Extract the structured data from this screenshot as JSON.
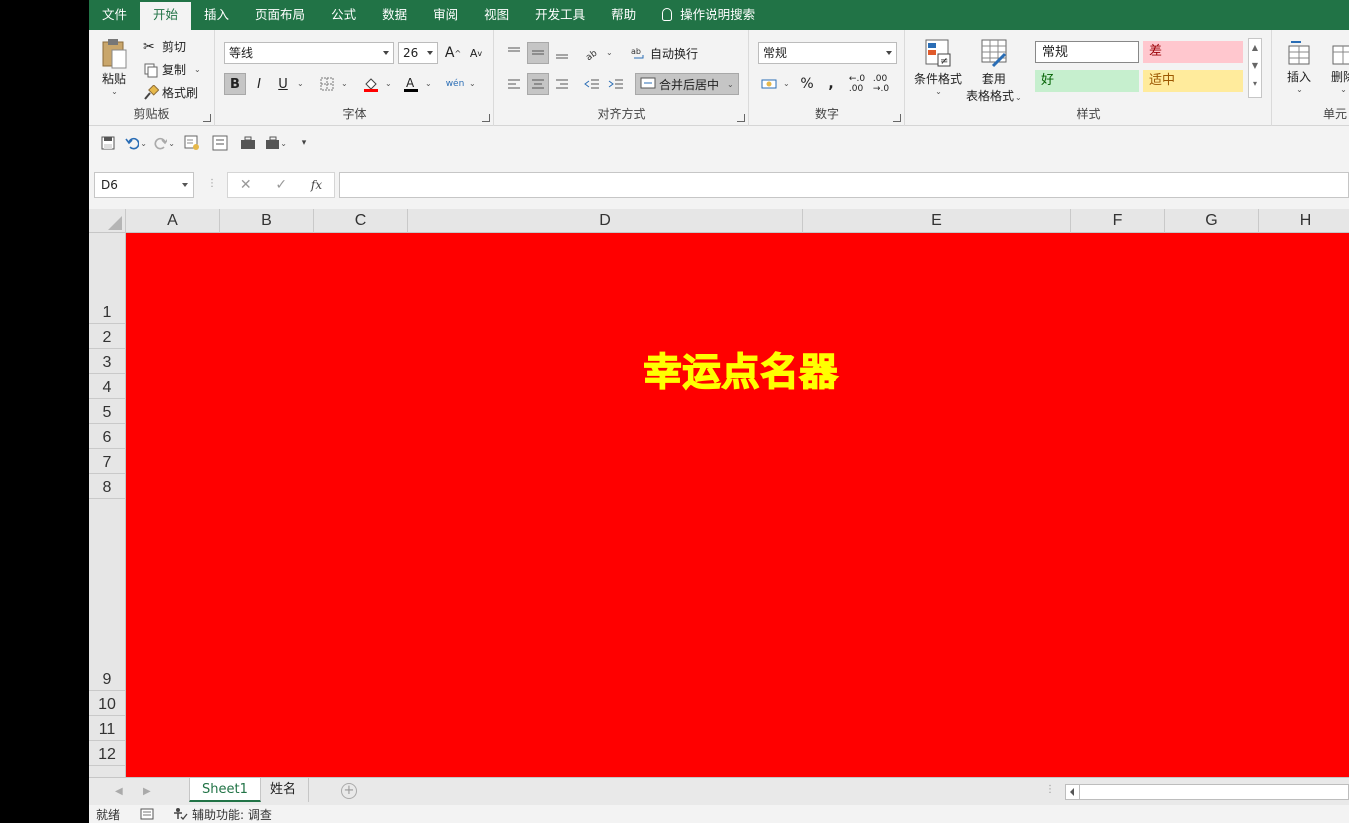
{
  "menu": [
    "文件",
    "开始",
    "插入",
    "页面布局",
    "公式",
    "数据",
    "审阅",
    "视图",
    "开发工具",
    "帮助"
  ],
  "menu_active_index": 1,
  "tell_me": "操作说明搜索",
  "ribbon": {
    "clipboard": {
      "label": "剪贴板",
      "paste": "粘贴",
      "cut": "剪切",
      "copy": "复制",
      "format_painter": "格式刷"
    },
    "font": {
      "label": "字体",
      "font_name": "等线",
      "font_size": "26",
      "bold": "B",
      "italic": "I",
      "underline": "U",
      "grow": "A",
      "shrink": "A"
    },
    "alignment": {
      "label": "对齐方式",
      "wrap": "自动换行",
      "merge": "合并后居中"
    },
    "number": {
      "label": "数字",
      "format": "常规",
      "percent": "%",
      "comma": ","
    },
    "styles": {
      "label": "样式",
      "conditional": "条件格式",
      "table_line1": "套用",
      "table_line2": "表格格式",
      "normal": "常规",
      "bad": "差",
      "good": "好",
      "neutral": "适中"
    },
    "cells": {
      "label": "单元",
      "insert": "插入",
      "delete": "删除"
    }
  },
  "formula_bar": {
    "name_box": "D6",
    "fx": "fx",
    "formula": ""
  },
  "columns": [
    "A",
    "B",
    "C",
    "D",
    "E",
    "F",
    "G",
    "H"
  ],
  "rows": [
    "1",
    "2",
    "3",
    "4",
    "5",
    "6",
    "7",
    "8",
    "9",
    "10",
    "11",
    "12"
  ],
  "sheet_title": "幸运点名器",
  "tabs": [
    "Sheet1",
    "姓名"
  ],
  "active_tab": 0,
  "status": {
    "ready": "就绪",
    "accessibility": "辅助功能: 调查"
  },
  "colors": {
    "excel_green": "#217346",
    "sheet_fill": "#ff0000",
    "title_color": "#ffff00",
    "bad_fill": "#ffc7ce",
    "good_fill": "#c6efce",
    "neutral_fill": "#ffeb9c"
  }
}
